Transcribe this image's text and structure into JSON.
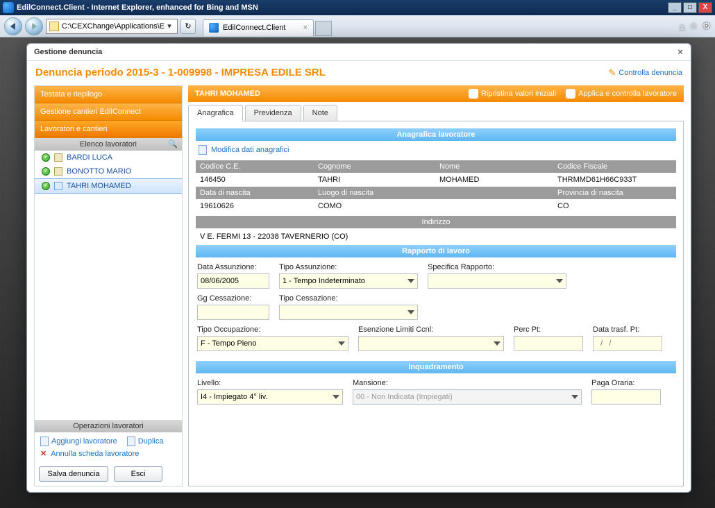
{
  "window": {
    "title": "EdilConnect.Client - Internet Explorer, enhanced for Bing and MSN"
  },
  "browser": {
    "address": "C:\\CEXChange\\Applications\\EdilCo",
    "tab_label": "EdilConnect.Client"
  },
  "modal": {
    "title": "Gestione denuncia",
    "heading": "Denuncia periodo 2015-3 - 1-009998 - IMPRESA EDILE SRL",
    "controlla": "Controlla denuncia"
  },
  "sidebar": {
    "sections": {
      "testata": "Testata e riepilogo",
      "cantieri": "Gestione cantieri EdilConnect",
      "lavoratori": "Lavoratori e cantieri"
    },
    "workers_head": "Elenco lavoratori",
    "workers": [
      {
        "name": "BARDI LUCA"
      },
      {
        "name": "BONOTTO MARIO"
      },
      {
        "name": "TAHRI MOHAMED"
      }
    ],
    "ops_head": "Operazioni lavoratori",
    "ops": {
      "aggiungi": "Aggiungi lavoratore",
      "duplica": "Duplica",
      "annulla": "Annulla scheda lavoratore"
    },
    "buttons": {
      "salva": "Salva denuncia",
      "esci": "Esci"
    }
  },
  "worker_bar": {
    "name": "TAHRI MOHAMED",
    "ripristina": "Ripristina valori iniziali",
    "applica": "Applica e controlla lavoratore"
  },
  "tabs": {
    "anagrafica": "Anagrafica",
    "previdenza": "Previdenza",
    "note": "Note"
  },
  "anag": {
    "section_title": "Anagrafica lavoratore",
    "edit_link": "Modifica dati anagrafici",
    "headers": {
      "codice_ce": "Codice C.E.",
      "cognome": "Cognome",
      "nome": "Nome",
      "cf": "Codice Fiscale",
      "data_nasc": "Data di nascita",
      "luogo_nasc": "Luogo di nascita",
      "prov_nasc": "Provincia di nascita"
    },
    "values": {
      "codice_ce": "146450",
      "cognome": "TAHRI",
      "nome": "MOHAMED",
      "cf": "THRMMD61H66C933T",
      "data_nasc": "19610626",
      "luogo_nasc": "COMO",
      "prov_nasc": "CO"
    },
    "indirizzo_label": "Indirizzo",
    "indirizzo": "V E. FERMI 13  - 22038 TAVERNERIO (CO)"
  },
  "rapporto": {
    "section_title": "Rapporto di lavoro",
    "labels": {
      "data_ass": "Data Assunzione:",
      "tipo_ass": "Tipo Assunzione:",
      "spec_rapp": "Specifica Rapporto:",
      "gg_cess": "Gg Cessazione:",
      "tipo_cess": "Tipo Cessazione:",
      "tipo_occ": "Tipo Occupazione:",
      "esenz": "Esenzione Limiti Ccnl:",
      "perc_pt": "Perc Pt:",
      "data_trasf": "Data trasf. Pt:"
    },
    "values": {
      "data_ass": "08/06/2005",
      "tipo_ass": "1 - Tempo Indeterminato",
      "spec_rapp": "",
      "gg_cess": "",
      "tipo_cess": "",
      "tipo_occ": "F - Tempo Pieno",
      "esenz": "",
      "perc_pt": "",
      "data_trasf_placeholder": "  /   /"
    }
  },
  "inquadramento": {
    "section_title": "Inquadramento",
    "labels": {
      "livello": "Livello:",
      "mansione": "Mansione:",
      "paga": "Paga Oraria:"
    },
    "values": {
      "livello": "I4 - Impiegato 4° liv.",
      "mansione_placeholder": "00 - Non Indicata (Impiegati)",
      "paga": ""
    }
  }
}
